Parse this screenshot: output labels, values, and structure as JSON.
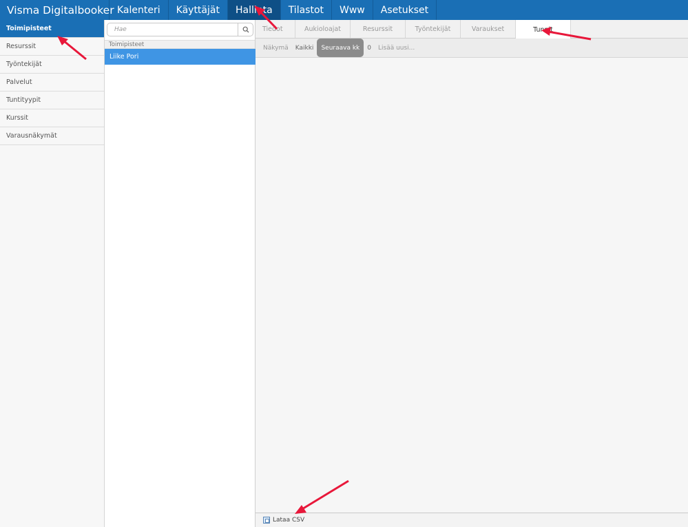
{
  "app": {
    "brand": "Visma Digitalbooker"
  },
  "nav": [
    {
      "label": "Kalenteri",
      "active": false
    },
    {
      "label": "Käyttäjät",
      "active": false
    },
    {
      "label": "Hallinta",
      "active": true
    },
    {
      "label": "Tilastot",
      "active": false
    },
    {
      "label": "Www",
      "active": false
    },
    {
      "label": "Asetukset",
      "active": false
    }
  ],
  "sidebar": {
    "items": [
      {
        "label": "Toimipisteet",
        "active": true
      },
      {
        "label": "Resurssit",
        "active": false
      },
      {
        "label": "Työntekijät",
        "active": false
      },
      {
        "label": "Palvelut",
        "active": false
      },
      {
        "label": "Tuntityypit",
        "active": false
      },
      {
        "label": "Kurssit",
        "active": false
      },
      {
        "label": "Varausnäkymät",
        "active": false
      }
    ]
  },
  "list": {
    "search_placeholder": "Hae",
    "search_icon": "search-icon",
    "header": "Toimipisteet",
    "rows": [
      {
        "label": "Liike Pori",
        "selected": true
      }
    ]
  },
  "tabs": [
    {
      "label": "Tiedot",
      "active": false
    },
    {
      "label": "Aukioloajat",
      "active": false
    },
    {
      "label": "Resurssit",
      "active": false
    },
    {
      "label": "Työntekijät",
      "active": false
    },
    {
      "label": "Varaukset",
      "active": false
    },
    {
      "label": "Tunnit",
      "active": true
    }
  ],
  "toolbar": {
    "view_label": "Näkymä",
    "all_label": "Kaikki",
    "next_month_label": "Seuraava kk",
    "count": "0",
    "add_new_label": "Lisää uusi..."
  },
  "footer": {
    "download_csv_label": "Lataa CSV"
  },
  "colors": {
    "nav_bg": "#1a6fb5",
    "nav_active": "#0e4f86",
    "selected_row": "#3f95e4",
    "annotation_arrow": "#e8173a"
  }
}
